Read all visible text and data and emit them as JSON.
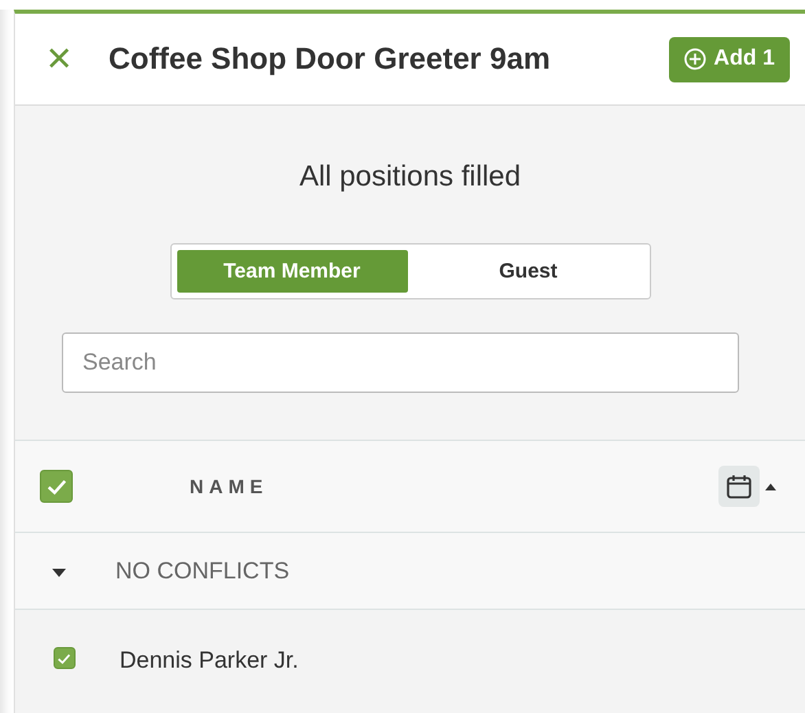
{
  "header": {
    "close_icon": "✕",
    "title": "Coffee Shop Door Greeter 9am",
    "add_button": "Add 1"
  },
  "status": "All positions filled",
  "toggle": [
    {
      "label": "Team Member",
      "selected": true
    },
    {
      "label": "Guest",
      "selected": false
    }
  ],
  "search": {
    "placeholder": "Search"
  },
  "table": {
    "select_all_checked": true,
    "column": "NAME",
    "groups": [
      {
        "label": "NO CONFLICTS",
        "expanded": true,
        "rows": [
          {
            "name": "Dennis Parker Jr.",
            "checked": true
          }
        ]
      }
    ]
  }
}
